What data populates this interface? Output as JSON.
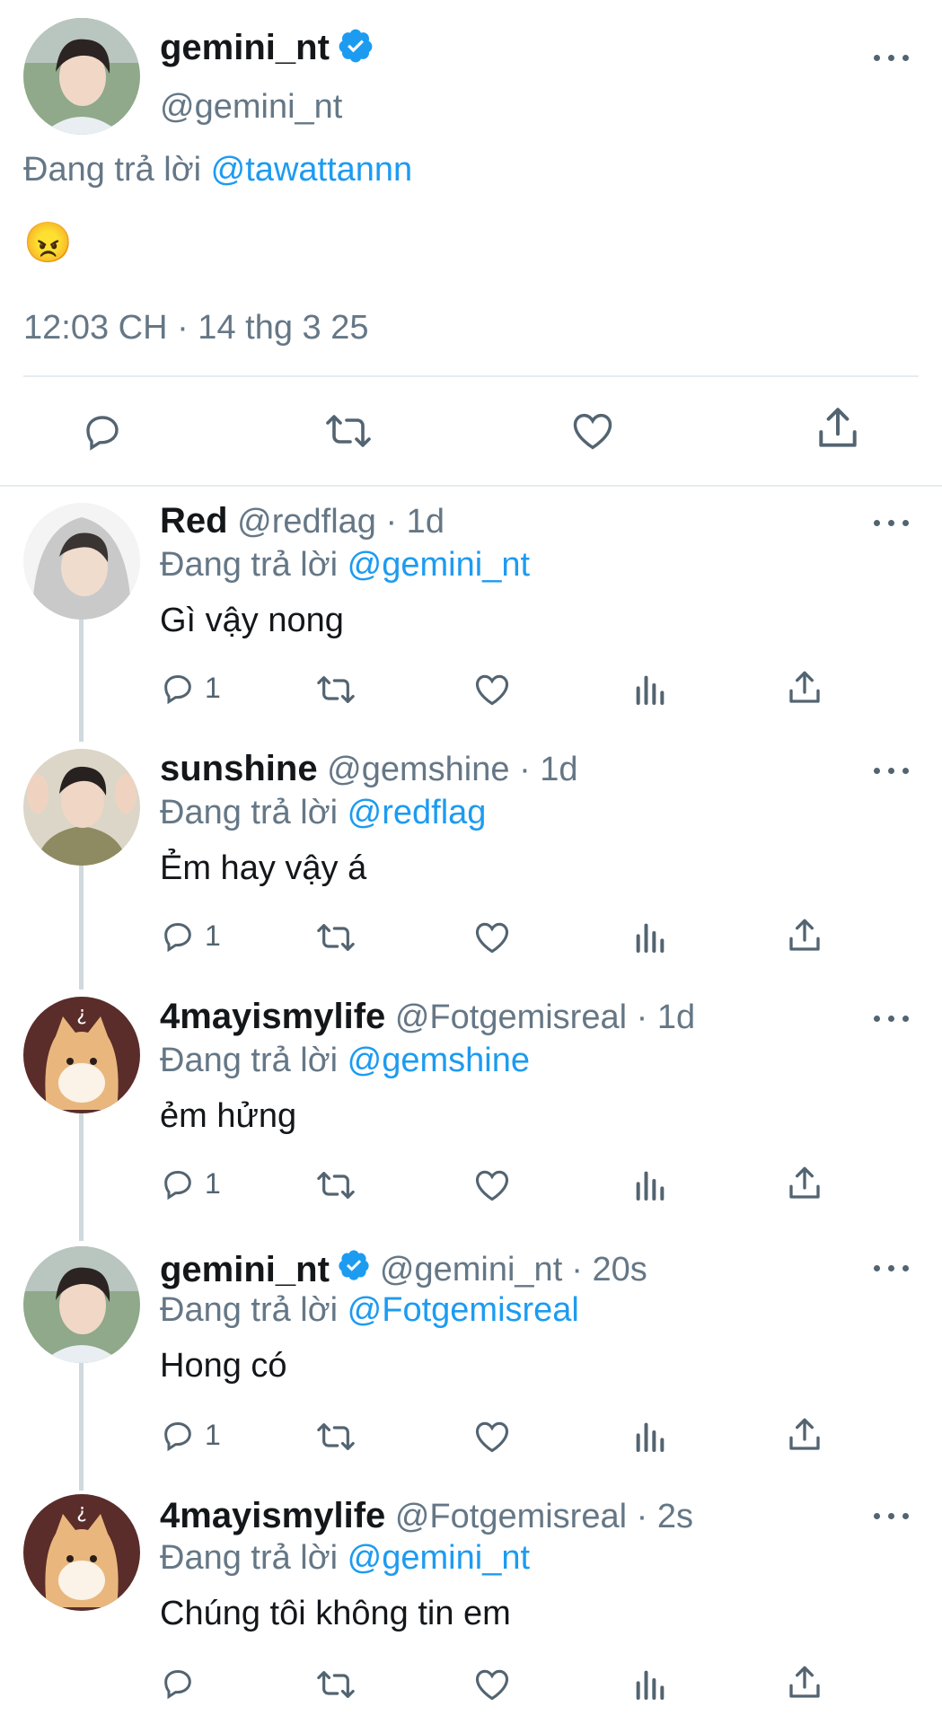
{
  "main_tweet": {
    "display_name": "gemini_nt",
    "handle": "@gemini_nt",
    "reply_prefix": "Đang trả lời",
    "reply_to": "@tawattannn",
    "content_emoji": "😠",
    "timestamp": "12:03 CH · 14 thg 3 25",
    "verified": true
  },
  "replies": [
    {
      "display_name": "Red",
      "handle": "@redflag",
      "time": "· 1d",
      "reply_prefix": "Đang trả lời",
      "reply_to": "@gemini_nt",
      "text": "Gì vậy nong",
      "reply_count": "1"
    },
    {
      "display_name": "sunshine",
      "handle": "@gemshine",
      "time": "· 1d",
      "reply_prefix": "Đang trả lời",
      "reply_to": "@redflag",
      "text": "Ẻm hay vậy á",
      "reply_count": "1"
    },
    {
      "display_name": "4mayismylife",
      "handle": "@Fotgemisreal",
      "time": "· 1d",
      "reply_prefix": "Đang trả lời",
      "reply_to": "@gemshine",
      "text": "ẻm hửng",
      "reply_count": "1"
    },
    {
      "display_name": "gemini_nt",
      "handle": "@gemini_nt",
      "time": "· 20s",
      "reply_prefix": "Đang trả lời",
      "reply_to": "@Fotgemisreal",
      "text": "Hong có",
      "reply_count": "1"
    },
    {
      "display_name": "4mayismylife",
      "handle": "@Fotgemisreal",
      "time": "· 2s",
      "reply_prefix": "Đang trả lời",
      "reply_to": "@gemini_nt",
      "text": "Chúng tôi không tin em",
      "reply_count": ""
    }
  ],
  "colors": {
    "link": "#1d9bf0",
    "muted": "#657786",
    "icon": "#536471",
    "verified": "#1d9bf0",
    "divider": "#e6ecf0"
  },
  "icons": [
    "more-icon",
    "verified-badge-icon",
    "reply-icon",
    "retweet-icon",
    "like-icon",
    "analytics-icon",
    "share-icon"
  ]
}
